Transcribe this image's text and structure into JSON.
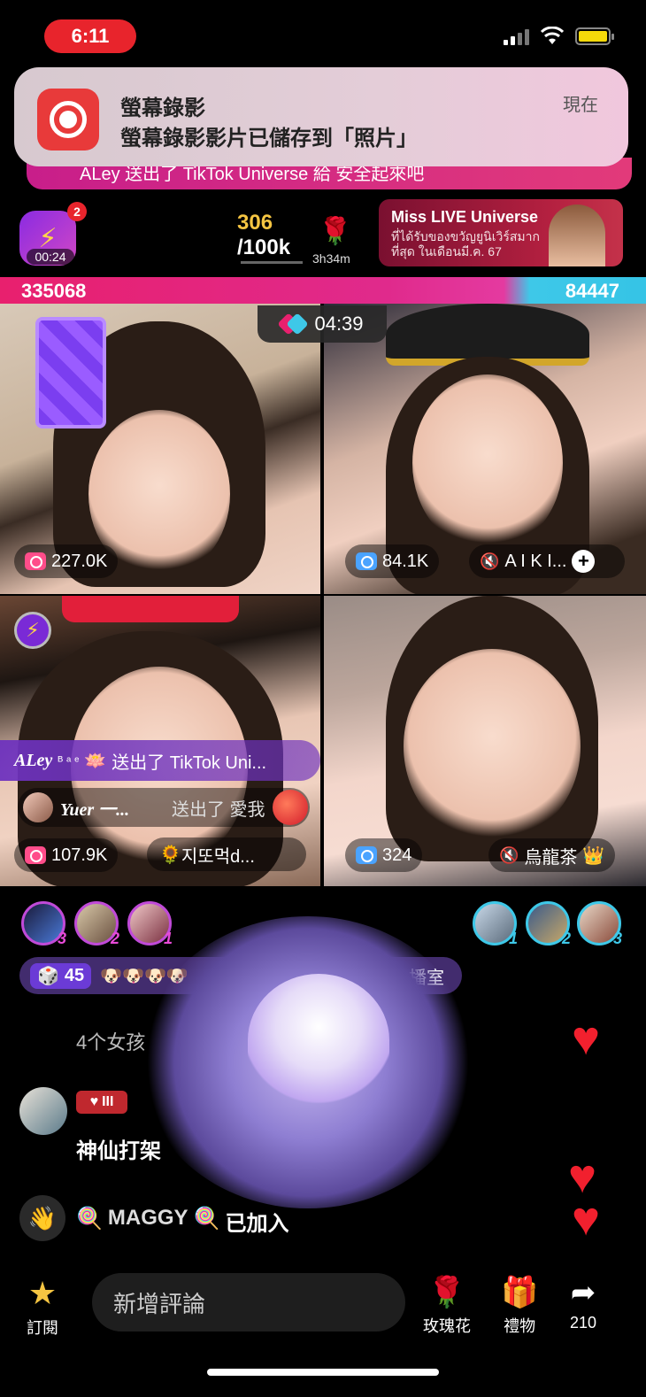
{
  "status_bar": {
    "time": "6:11"
  },
  "notification": {
    "app": "螢幕錄影",
    "message": "螢幕錄影影片已儲存到「照片」",
    "time": "現在"
  },
  "ticker": {
    "text": "ALey  送出了 TikTok Universe 給 安全起來吧"
  },
  "top": {
    "badge_count": "2",
    "bolt_timer": "00:24",
    "goal_current": "306",
    "goal_total": "/100k",
    "rose_timer": "3h34m",
    "banner_title": "Miss LIVE Universe",
    "banner_sub": "ที่ได้รับของขวัญยูนิเวิร์สมากที่สุด ในเดือนมี.ค. 67"
  },
  "battle": {
    "score_left": "335068",
    "score_right": "84447",
    "timer": "04:39"
  },
  "tiles": [
    {
      "count": "227.0K"
    },
    {
      "count": "84.1K",
      "name": "A I K I..."
    },
    {
      "count": "107.9K",
      "name": "지또먹d..."
    },
    {
      "count": "324",
      "name": "烏龍茶"
    }
  ],
  "gift_feed": {
    "row1_user": "ALey",
    "row1_suffix": "ᴮ ᵃ ᵉ",
    "row1_text": "送出了 TikTok Uni...",
    "row2_user": "Yuer 一...",
    "row2_text": "送出了 愛我"
  },
  "ranks_left": [
    "3",
    "2",
    "1"
  ],
  "ranks_right": [
    "1",
    "2",
    "3"
  ],
  "chat": {
    "gem_count": "45",
    "gem_suffix": "播室",
    "faded_line": "4个女孩",
    "level": "III",
    "message": "神仙打架",
    "join_user": "MAGGY",
    "join_text": "已加入"
  },
  "bottom_bar": {
    "subscribe": "訂閱",
    "comment_placeholder": "新增評論",
    "rose": "玫瑰花",
    "gift": "禮物",
    "share_count": "210"
  }
}
